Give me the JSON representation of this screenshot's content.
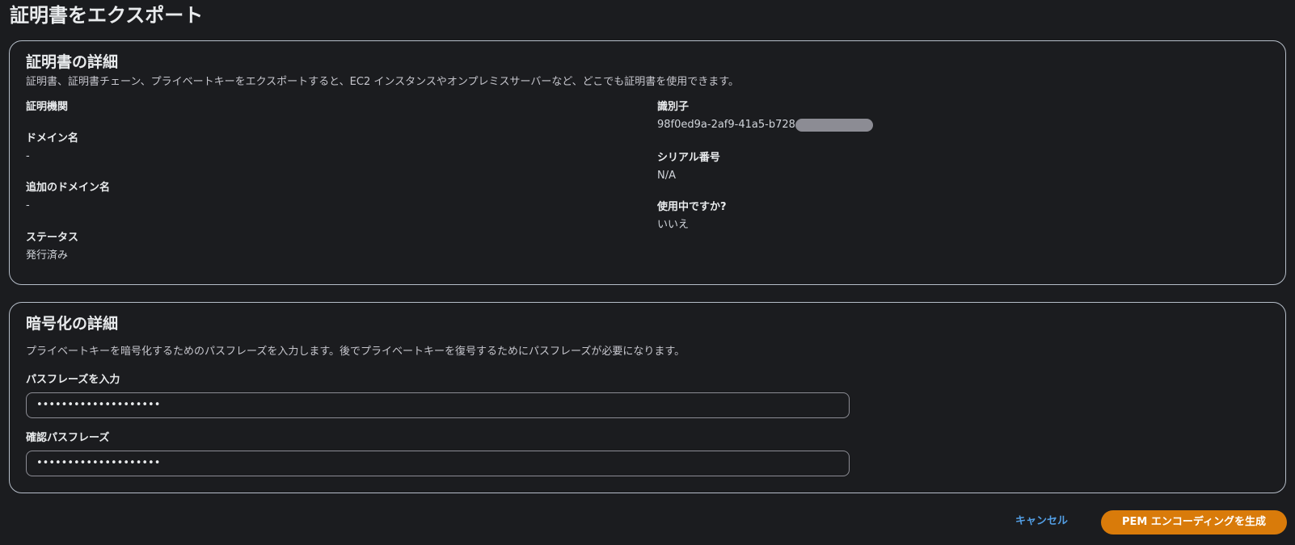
{
  "page": {
    "title": "証明書をエクスポート"
  },
  "details": {
    "title": "証明書の詳細",
    "description": "証明書、証明書チェーン、プライベートキーをエクスポートすると、EC2 インスタンスやオンプレミスサーバーなど、どこでも証明書を使用できます。",
    "left_fields": [
      {
        "label": "証明機関",
        "value": ""
      },
      {
        "label": "ドメイン名",
        "value": "-"
      },
      {
        "label": "追加のドメイン名",
        "value": "-"
      },
      {
        "label": "ステータス",
        "value": "発行済み"
      }
    ],
    "right_fields": [
      {
        "label": "識別子",
        "value": "98f0ed9a-2af9-41a5-b728"
      },
      {
        "label": "シリアル番号",
        "value": "N/A"
      },
      {
        "label": "使用中ですか?",
        "value": "いいえ"
      }
    ]
  },
  "encryption": {
    "title": "暗号化の詳細",
    "description": "プライベートキーを暗号化するためのパスフレーズを入力します。後でプライベートキーを復号するためにパスフレーズが必要になります。",
    "passphrase_label": "パスフレーズを入力",
    "passphrase_value": "••••••••••••••••••••",
    "confirm_label": "確認パスフレーズ",
    "confirm_value": "••••••••••••••••••••"
  },
  "actions": {
    "cancel_label": "キャンセル",
    "generate_label": "PEM エンコーディングを生成"
  },
  "colors": {
    "background": "#1b1c1f",
    "panel_border": "#b6bec9",
    "link": "#539fe5",
    "primary_button": "#d97b0a"
  }
}
